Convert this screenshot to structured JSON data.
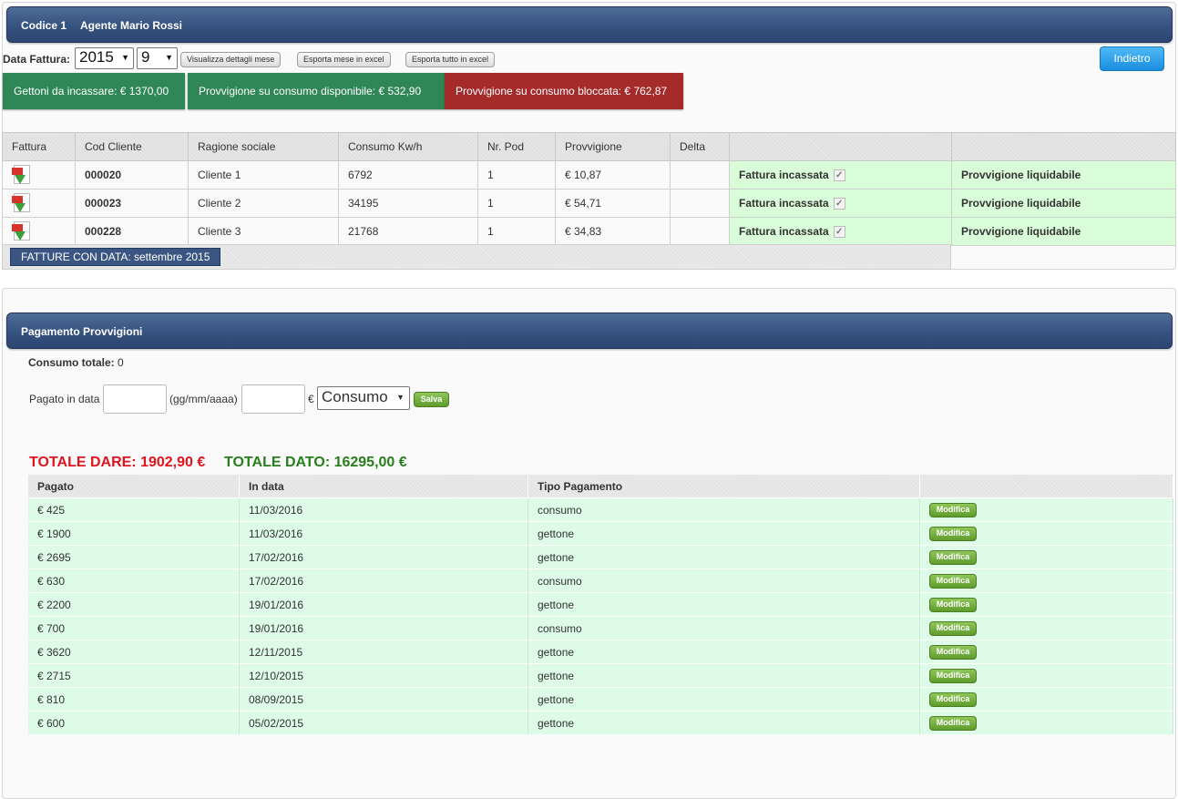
{
  "header": {
    "codice": "Codice 1",
    "agente": "Agente Mario Rossi"
  },
  "filters": {
    "label": "Data Fattura:",
    "year": "2015",
    "month": "9",
    "buttons": [
      "Visualizza dettagli mese",
      "Esporta mese in excel",
      "Esporta tutto in excel"
    ],
    "back_label": "Indietro"
  },
  "stats": {
    "gettoni": "Gettoni da incassare: € 1370,00",
    "disponibile": "Provvigione su consumo disponibile: € 532,90",
    "bloccata": "Provvigione su consumo bloccata: € 762,87",
    "colors": {
      "green": "#2f8757",
      "red": "#a52a2a"
    }
  },
  "invoices": {
    "columns": [
      "Fattura",
      "Cod Cliente",
      "Ragione sociale",
      "Consumo Kw/h",
      "Nr. Pod",
      "Provvigione",
      "Delta",
      "",
      ""
    ],
    "rows": [
      {
        "cod": "000020",
        "ragione": "Cliente 1",
        "consumo": "6792",
        "pod": "1",
        "provvigione": "€ 10,87",
        "delta": "",
        "stato": "Fattura incassata",
        "liquid": "Provvigione liquidabile"
      },
      {
        "cod": "000023",
        "ragione": "Cliente 2",
        "consumo": "34195",
        "pod": "1",
        "provvigione": "€ 54,71",
        "delta": "",
        "stato": "Fattura incassata",
        "liquid": "Provvigione liquidabile"
      },
      {
        "cod": "000228",
        "ragione": "Cliente 3",
        "consumo": "21768",
        "pod": "1",
        "provvigione": "€ 34,83",
        "delta": "",
        "stato": "Fattura incassata",
        "liquid": "Provvigione liquidabile"
      }
    ],
    "footer_label": "FATTURE CON DATA: settembre 2015"
  },
  "payments": {
    "title": "Pagamento Provvigioni",
    "consumo_label": "Consumo totale:",
    "consumo_value": " 0",
    "pagato_label": "Pagato in data",
    "date_format": "(gg/mm/aaaa)",
    "euro": "€",
    "tipo_selected": "Consumo",
    "salva_label": "Salva",
    "totale_dare": "TOTALE DARE: 1902,90 €",
    "totale_dato": "TOTALE DATO: 16295,00 €",
    "columns": [
      "Pagato",
      "In data",
      "Tipo Pagamento",
      ""
    ],
    "modifica_label": "Modifica",
    "rows": [
      {
        "pagato": "€ 425",
        "data": "11/03/2016",
        "tipo": "consumo"
      },
      {
        "pagato": "€ 1900",
        "data": "11/03/2016",
        "tipo": "gettone"
      },
      {
        "pagato": "€ 2695",
        "data": "17/02/2016",
        "tipo": "gettone"
      },
      {
        "pagato": "€ 630",
        "data": "17/02/2016",
        "tipo": "consumo"
      },
      {
        "pagato": "€ 2200",
        "data": "19/01/2016",
        "tipo": "gettone"
      },
      {
        "pagato": "€ 700",
        "data": "19/01/2016",
        "tipo": "consumo"
      },
      {
        "pagato": "€ 3620",
        "data": "12/11/2015",
        "tipo": "gettone"
      },
      {
        "pagato": "€ 2715",
        "data": "12/10/2015",
        "tipo": "gettone"
      },
      {
        "pagato": "€ 810",
        "data": "08/09/2015",
        "tipo": "gettone"
      },
      {
        "pagato": "€ 600",
        "data": "05/02/2015",
        "tipo": "gettone"
      }
    ]
  }
}
